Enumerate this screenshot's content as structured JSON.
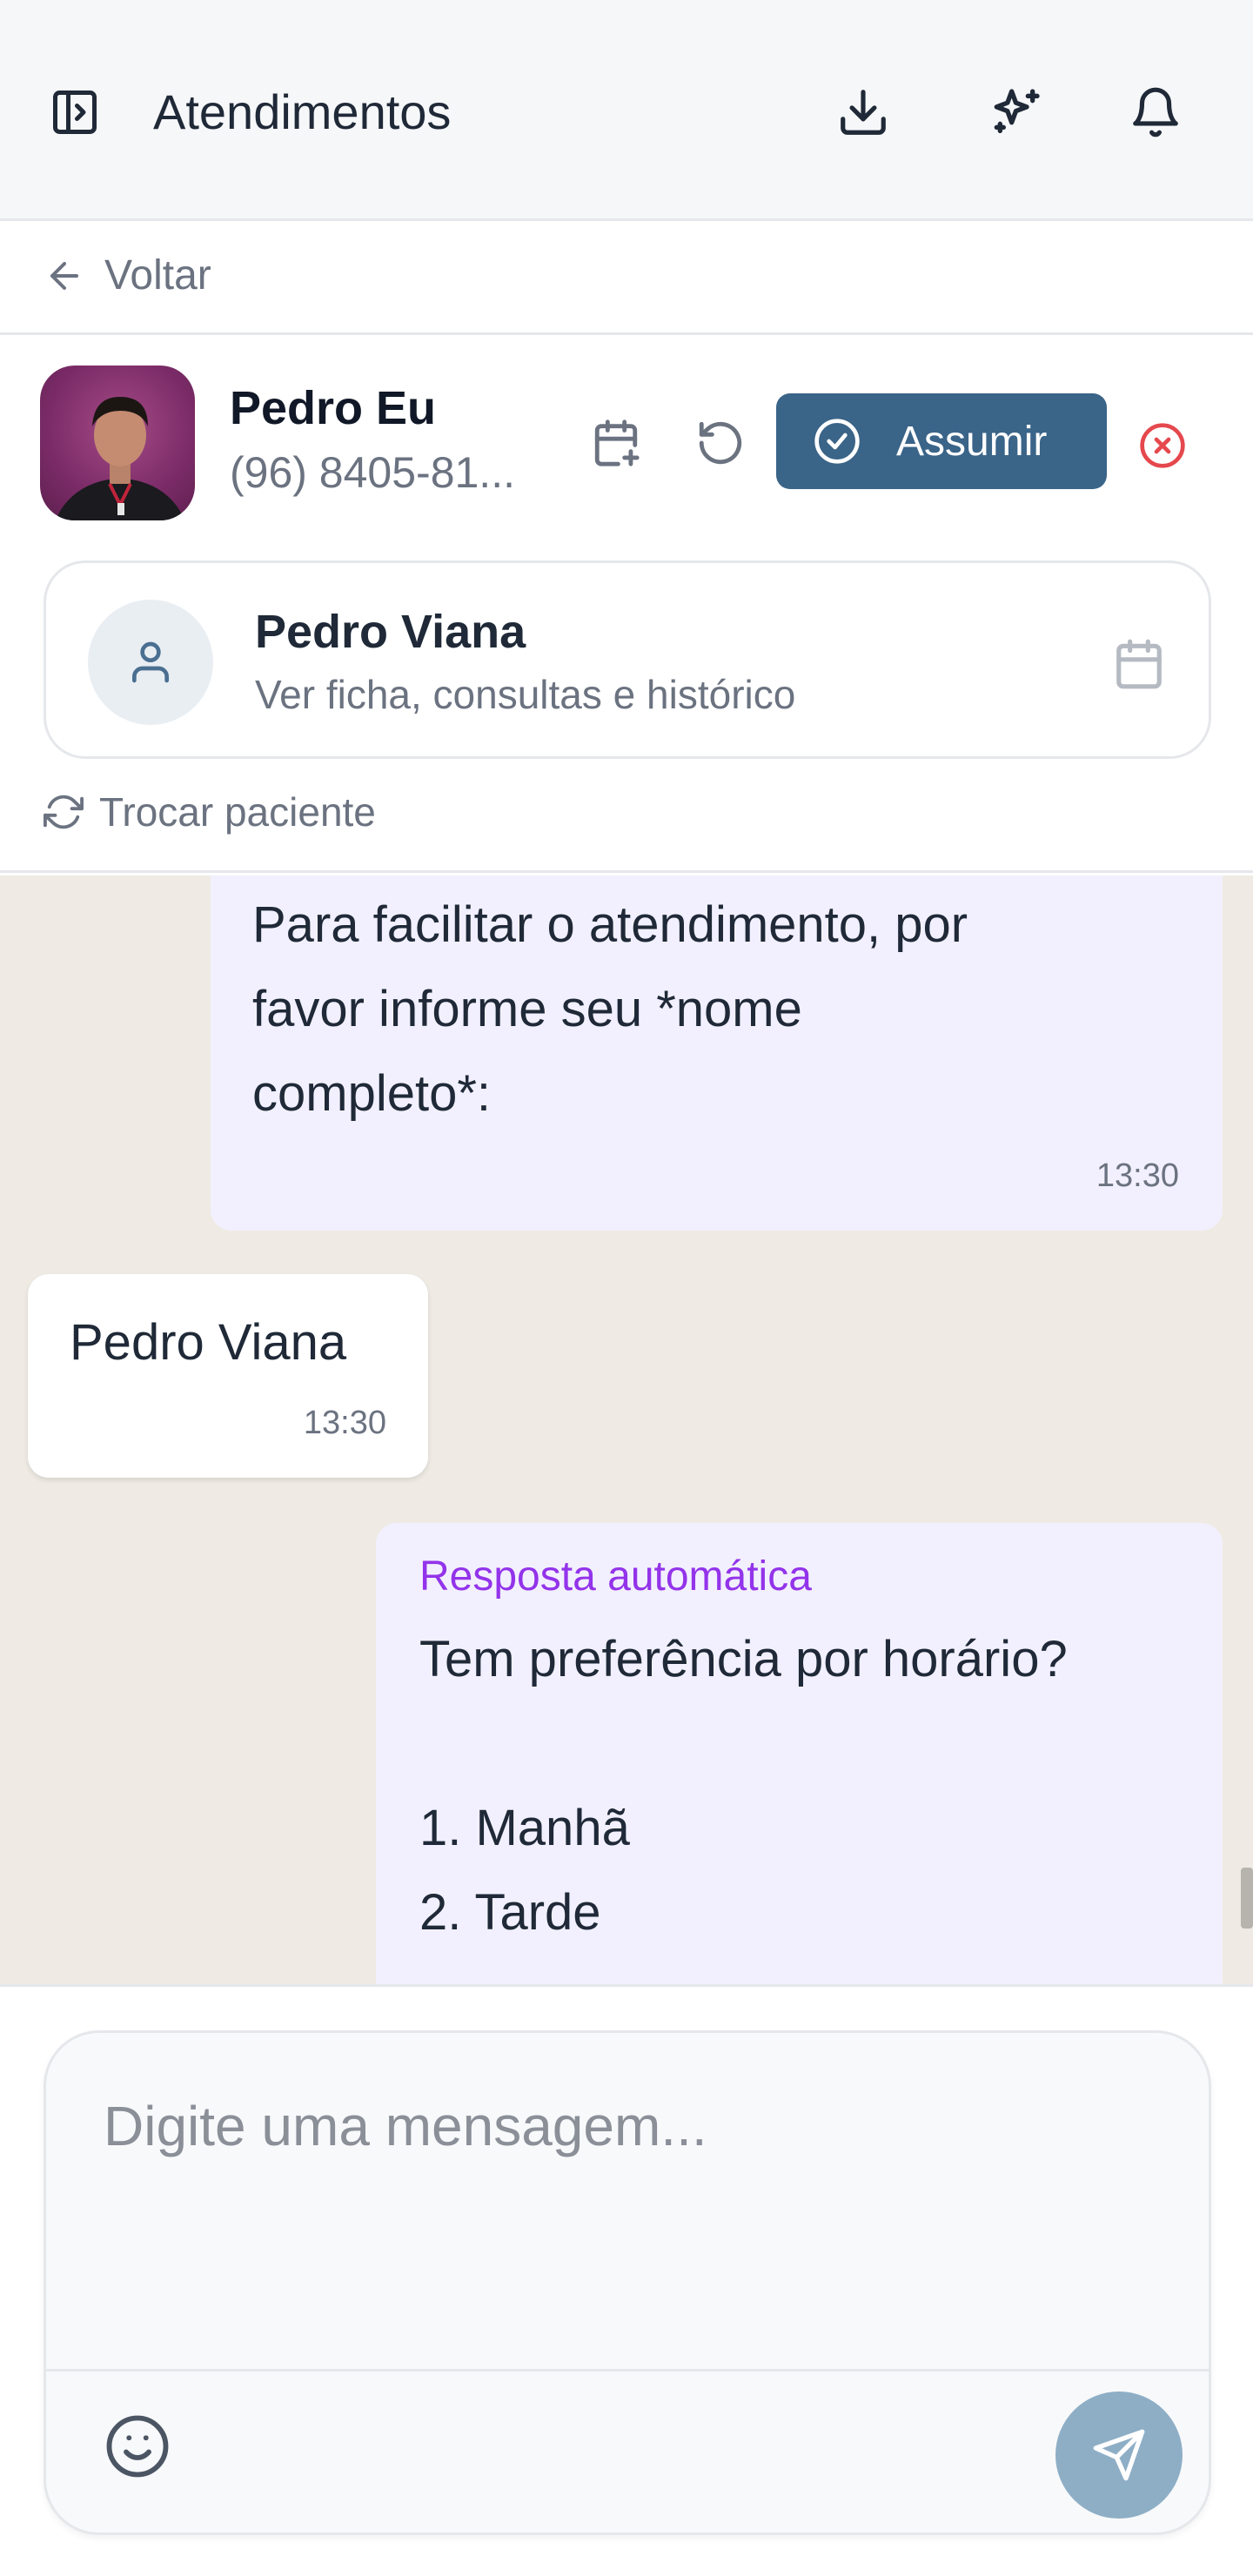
{
  "header": {
    "title": "Atendimentos",
    "icons": [
      "sidebar-toggle-icon",
      "download-icon",
      "sparkles-icon",
      "bell-icon"
    ]
  },
  "nav": {
    "back_label": "Voltar"
  },
  "contact": {
    "name": "Pedro Eu",
    "phone": "(96) 8405-81...",
    "assume_label": "Assumir",
    "colors": {
      "assume_button": "#3a6488",
      "close_icon": "#e5484d"
    }
  },
  "patient": {
    "name": "Pedro Viana",
    "subtitle": "Ver ficha, consultas e histórico",
    "swap_label": "Trocar paciente"
  },
  "messages": [
    {
      "direction": "outgoing",
      "text": "Para facilitar o atendimento, por\nfavor informe seu *nome\ncompleto*:",
      "time": "13:30"
    },
    {
      "direction": "incoming",
      "text": "Pedro Viana",
      "time": "13:30"
    },
    {
      "direction": "outgoing",
      "label": "Resposta automática",
      "text": "Tem preferência por horário?\n\n1. Manhã\n2. Tarde"
    }
  ],
  "composer": {
    "placeholder": "Digite uma mensagem..."
  },
  "colors": {
    "chat_background": "#efebe4",
    "outgoing_bubble": "#f2f0fe",
    "incoming_bubble": "#ffffff",
    "auto_label": "#9333ea",
    "send_button": "#8eaec6"
  }
}
